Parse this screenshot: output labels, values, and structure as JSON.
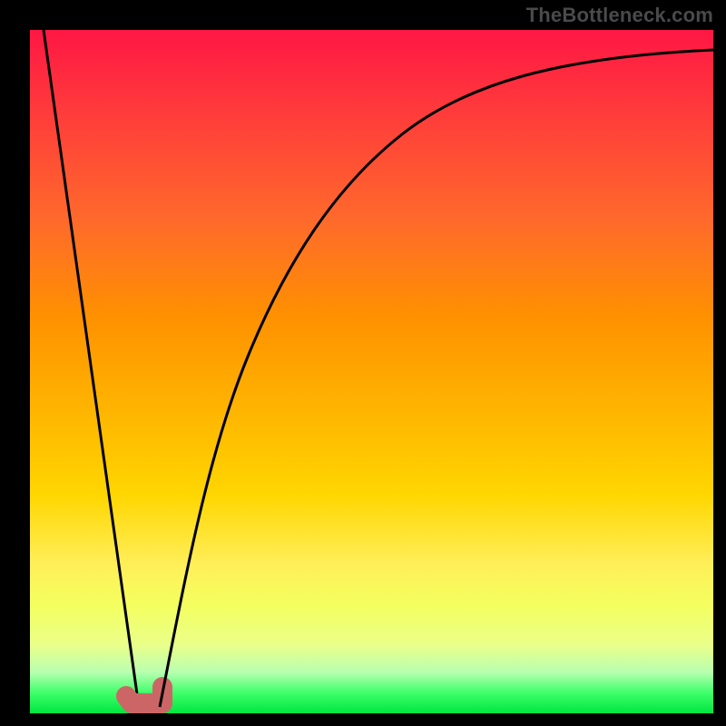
{
  "watermark": "TheBottleneck.com",
  "colors": {
    "page_background": "#000000",
    "curve_stroke": "#000000",
    "bottom_marker_stroke": "#cc6666",
    "watermark_text": "#4a4a4a",
    "gradient_stops": [
      "#ff1744",
      "#ff3b3b",
      "#ff6a2b",
      "#ff9100",
      "#ffb300",
      "#ffd600",
      "#ffee58",
      "#f4ff5e",
      "#eaff8a",
      "#b8ffb0",
      "#3eff6a",
      "#00e640"
    ]
  },
  "chart_data": {
    "type": "line",
    "title": "",
    "xlabel": "",
    "ylabel": "",
    "x_range": [
      0,
      100
    ],
    "y_range": [
      0,
      100
    ],
    "note": "Curve dips from near 100 at x≈2 down to ~0 at x≈15–19, then rises asymptotically approaching ~97 by x=100. Bottom salmon marker spans roughly x≈14–20 at y≈1.",
    "series": [
      {
        "name": "left-descent",
        "x": [
          2,
          4,
          6,
          8,
          10,
          12,
          14,
          16
        ],
        "y": [
          100,
          86,
          71,
          57,
          43,
          29,
          14,
          1
        ]
      },
      {
        "name": "right-rise",
        "x": [
          19,
          24,
          30,
          36,
          42,
          50,
          58,
          66,
          76,
          88,
          100
        ],
        "y": [
          1,
          25,
          46,
          60,
          70,
          78,
          84,
          88,
          92,
          95,
          97
        ]
      }
    ],
    "bottom_marker": {
      "x_start": 14,
      "x_end": 20,
      "y": 1
    }
  }
}
